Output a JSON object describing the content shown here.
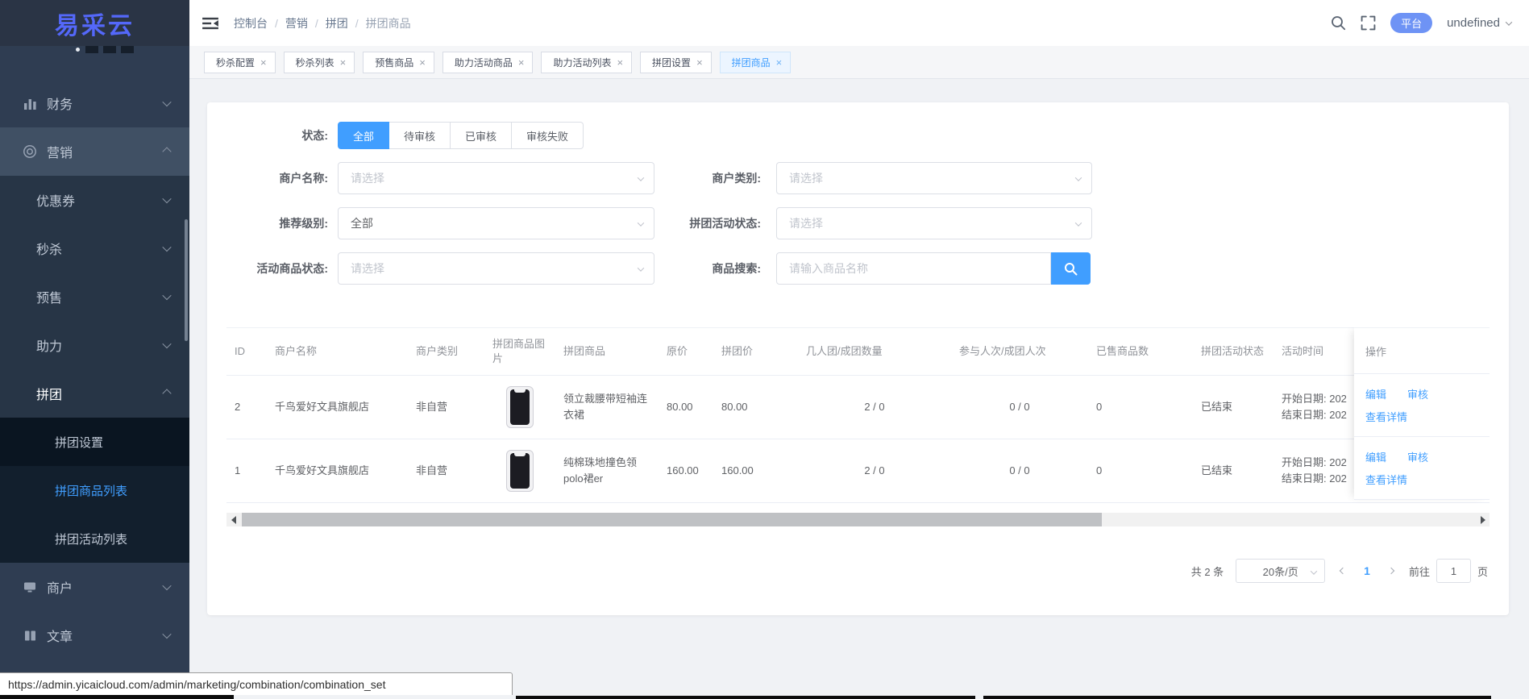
{
  "app": {
    "name": "易采云"
  },
  "colors": {
    "primary": "#409eff",
    "logo_blue": "#5468fa",
    "badge_blue": "#6e93f5",
    "sidebar_bg": "#2f3d52",
    "active_menu_text": "#409eff"
  },
  "icons": {
    "close": "×"
  },
  "topbar": {
    "breadcrumb": {
      "items": [
        "控制台",
        "营销",
        "拼团",
        "拼团商品"
      ],
      "separator": "/"
    },
    "platform_badge": "平台",
    "username": "undefined"
  },
  "tabs": [
    {
      "label": "秒杀配置",
      "active": false
    },
    {
      "label": "秒杀列表",
      "active": false
    },
    {
      "label": "预售商品",
      "active": false
    },
    {
      "label": "助力活动商品",
      "active": false
    },
    {
      "label": "助力活动列表",
      "active": false
    },
    {
      "label": "拼团设置",
      "active": false
    },
    {
      "label": "拼团商品",
      "active": true
    }
  ],
  "sidebar": {
    "items": [
      {
        "label": "财务",
        "icon": "chart-icon",
        "level": 1
      },
      {
        "label": "营销",
        "icon": "marketing-icon",
        "level": 1,
        "expanded": true
      },
      {
        "label": "优惠券",
        "level": 2
      },
      {
        "label": "秒杀",
        "level": 2
      },
      {
        "label": "预售",
        "level": 2
      },
      {
        "label": "助力",
        "level": 2
      },
      {
        "label": "拼团",
        "level": 2,
        "expanded": true
      },
      {
        "label": "拼团设置",
        "level": 3
      },
      {
        "label": "拼团商品列表",
        "level": 3,
        "active": true
      },
      {
        "label": "拼团活动列表",
        "level": 3
      },
      {
        "label": "商户",
        "icon": "shop-icon",
        "level": 1
      },
      {
        "label": "文章",
        "icon": "article-icon",
        "level": 1
      }
    ]
  },
  "filters": {
    "status": {
      "label": "状态:",
      "options": [
        "全部",
        "待审核",
        "已审核",
        "审核失败"
      ],
      "selected": "全部"
    },
    "merchant_name": {
      "label": "商户名称:",
      "placeholder": "请选择"
    },
    "merchant_type": {
      "label": "商户类别:",
      "placeholder": "请选择"
    },
    "recommend_level": {
      "label": "推荐级别:",
      "value": "全部"
    },
    "activity_status": {
      "label": "拼团活动状态:",
      "placeholder": "请选择"
    },
    "product_status": {
      "label": "活动商品状态:",
      "placeholder": "请选择"
    },
    "product_search": {
      "label": "商品搜索:",
      "placeholder": "请输入商品名称"
    }
  },
  "table": {
    "columns": [
      "ID",
      "商户名称",
      "商户类别",
      "拼团商品图片",
      "拼团商品",
      "原价",
      "拼团价",
      "几人团/成团数量",
      "参与人次/成团人次",
      "已售商品数",
      "拼团活动状态",
      "活动时间",
      "操作"
    ],
    "rows": [
      {
        "id": "2",
        "merchant": "千鸟爱好文具旗舰店",
        "type": "非自营",
        "product": "领立裁腰带短袖连衣裙",
        "price": "80.00",
        "group_price": "80.00",
        "group_count": "2 / 0",
        "join_count": "0 / 0",
        "sold": "0",
        "status": "已结束",
        "start": "开始日期: 202",
        "end": "结束日期: 202"
      },
      {
        "id": "1",
        "merchant": "千鸟爱好文具旗舰店",
        "type": "非自营",
        "product": "纯棉珠地撞色领polo裙er",
        "price": "160.00",
        "group_price": "160.00",
        "group_count": "2 / 0",
        "join_count": "0 / 0",
        "sold": "0",
        "status": "已结束",
        "start": "开始日期: 202",
        "end": "结束日期: 202"
      }
    ],
    "actions": {
      "edit": "编辑",
      "review": "审核",
      "detail": "查看详情"
    }
  },
  "pagination": {
    "total": "共 2 条",
    "page_size": "20条/页",
    "current": "1",
    "goto_label": "前往",
    "goto_value": "1",
    "page_label": "页"
  },
  "statusbar": {
    "url": "https://admin.yicaicloud.com/admin/marketing/combination/combination_set"
  }
}
